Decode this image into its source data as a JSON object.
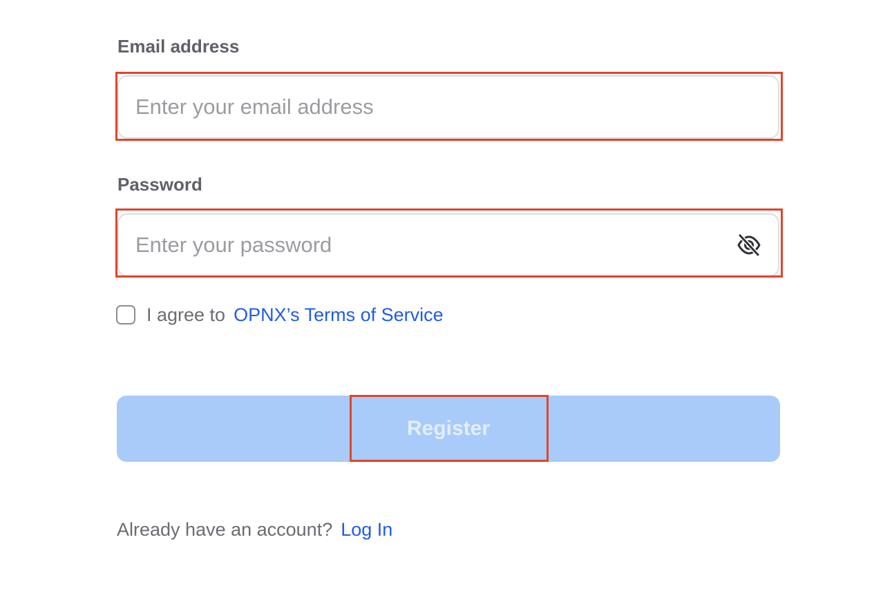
{
  "form": {
    "email": {
      "label": "Email address",
      "placeholder": "Enter your email address",
      "value": ""
    },
    "password": {
      "label": "Password",
      "placeholder": "Enter your password",
      "value": "",
      "toggle_icon": "eye-off-icon"
    },
    "terms": {
      "checked": false,
      "text": "I agree to",
      "link_label": "OPNX’s Terms of Service"
    },
    "register_label": "Register",
    "login_prompt": "Already have an account?",
    "login_link": "Log In"
  },
  "colors": {
    "link": "#1f5ce6",
    "button_bg": "#a8cbfa",
    "button_text": "#e4eefd",
    "highlight": "#e0442a"
  }
}
